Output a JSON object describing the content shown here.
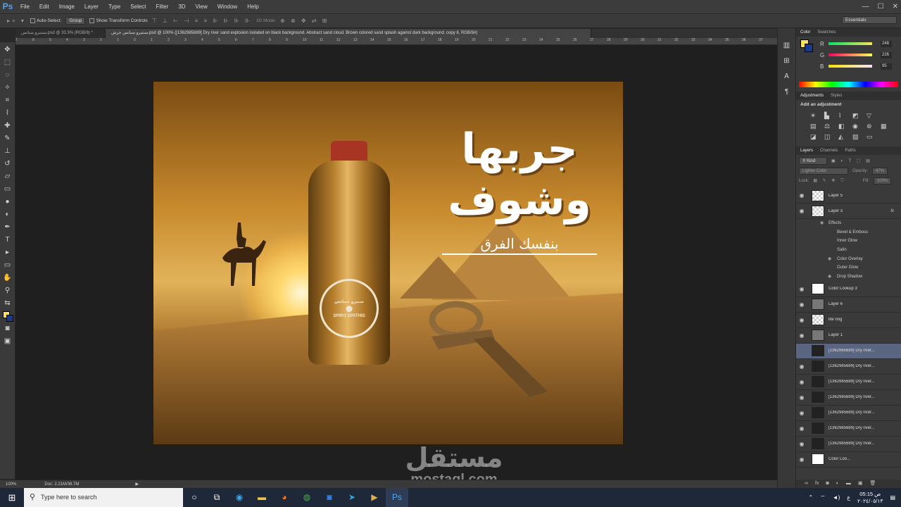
{
  "app": {
    "logo": "Ps"
  },
  "menu": [
    "File",
    "Edit",
    "Image",
    "Layer",
    "Type",
    "Select",
    "Filter",
    "3D",
    "View",
    "Window",
    "Help"
  ],
  "options_bar": {
    "auto_select_label": "Auto-Select:",
    "auto_select_value": "Group",
    "transform_label": "Show Transform Controls",
    "mode_label": "3D Mode:",
    "workspace": "Essentials"
  },
  "tabs": [
    {
      "label": "سنتيرو سباتس.psd @ 33.3% (RGB/8) *"
    },
    {
      "label": "سنتيرو سباتس جرش.psd @ 100% ([1362985689] Dry river sand explosion isolated on black background. Abstract sand cloud. Brown colored sand splash against dark background. copy 8, RGB/8#)"
    }
  ],
  "ruler_ticks": [
    "7",
    "6",
    "5",
    "4",
    "3",
    "2",
    "1",
    "0",
    "1",
    "2",
    "3",
    "4",
    "5",
    "6",
    "7",
    "8",
    "9",
    "10",
    "11",
    "12",
    "13",
    "14",
    "15",
    "16",
    "17",
    "18",
    "19",
    "20",
    "21",
    "22",
    "23",
    "24",
    "25",
    "26",
    "27",
    "28",
    "29",
    "30",
    "31",
    "32",
    "33",
    "34",
    "35",
    "36",
    "37"
  ],
  "artwork": {
    "headline_line1": "جربها",
    "headline_line2": "وشوف",
    "subline": "بنفسك الفرق",
    "label_ar": "سبيرو سباتس",
    "label_en": "SPIRO SPATHIS"
  },
  "status": {
    "zoom": "100%",
    "doc": "Doc: 2.21M/38.7M"
  },
  "color_panel": {
    "tabs": [
      "Color",
      "Swatches"
    ],
    "channels": [
      {
        "label": "R",
        "value": "248",
        "color": "#e8c96a"
      },
      {
        "label": "G",
        "value": "226",
        "color": "#d8b84a"
      },
      {
        "label": "B",
        "value": "95",
        "color": "#c8a030"
      }
    ],
    "fg_color": "#f8e25f",
    "bg_color": "#1b3a8a"
  },
  "adjustments_panel": {
    "tabs": [
      "Adjustments",
      "Styles"
    ],
    "title": "Add an adjustment"
  },
  "layers_panel": {
    "tabs": [
      "Layers",
      "Channels",
      "Paths"
    ],
    "kind_label": "Kind",
    "blend_mode": "Lighter Color",
    "opacity_label": "Opacity:",
    "opacity_value": "47%",
    "lock_label": "Lock:",
    "fill_label": "Fill:",
    "fill_value": "100%",
    "layers_top": [
      {
        "name": "Layer 5",
        "thumb": "checker",
        "fx": ""
      },
      {
        "name": "Layer 3",
        "thumb": "checker",
        "fx": "fx"
      }
    ],
    "effects": [
      "Effects",
      "Bevel & Emboss",
      "Inner Glow",
      "Satin",
      "Color Overlay",
      "Outer Glow",
      "Drop Shadow"
    ],
    "layers_bottom": [
      {
        "name": "Color Lookup 3",
        "thumb": "white"
      },
      {
        "name": "Layer 6",
        "thumb": "gray"
      },
      {
        "name": "lite ring",
        "thumb": "checker"
      },
      {
        "name": "Layer 1",
        "thumb": "gray"
      },
      {
        "name": "[1362985689] Dry river...",
        "thumb": "dark",
        "selected": true
      },
      {
        "name": "[1362985689] Dry river...",
        "thumb": "dark"
      },
      {
        "name": "[1362985689] Dry river...",
        "thumb": "dark"
      },
      {
        "name": "[1362985689] Dry river...",
        "thumb": "dark"
      },
      {
        "name": "[1362985689] Dry river...",
        "thumb": "dark"
      },
      {
        "name": "[1362985689] Dry river...",
        "thumb": "dark"
      },
      {
        "name": "[1362985689] Dry river...",
        "thumb": "dark"
      },
      {
        "name": "Color Loo...",
        "thumb": "white"
      }
    ]
  },
  "watermark": {
    "ar": "مستقل",
    "en": "mostaql.com"
  },
  "taskbar": {
    "search_placeholder": "Type here to search",
    "time": "05:15 ص",
    "date": "٢٠٢٤/٠٥/١٣",
    "lang": "ع"
  }
}
